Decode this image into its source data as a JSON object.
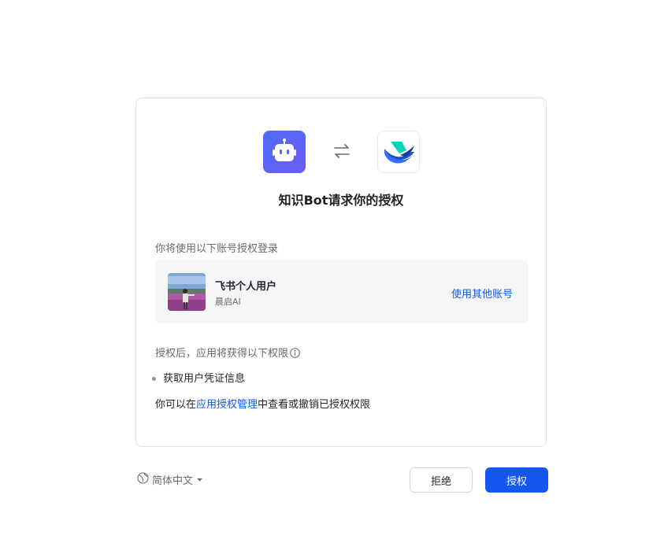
{
  "header": {
    "app_icon": "robot-icon",
    "swap_icon": "swap-arrows-icon",
    "target_icon": "feishu-logo-icon",
    "title": "知识Bot请求你的授权"
  },
  "account": {
    "section_label": "你将使用以下账号授权登录",
    "name": "飞书个人用户",
    "org": "晨启AI",
    "switch_label": "使用其他账号"
  },
  "permissions": {
    "label": "授权后，应用将获得以下权限",
    "items": [
      "获取用户凭证信息"
    ],
    "manage_prefix": "你可以在",
    "manage_link": "应用授权管理",
    "manage_suffix": "中查看或撤销已授权权限"
  },
  "footer": {
    "language": "简体中文",
    "reject_label": "拒绝",
    "authorize_label": "授权"
  },
  "colors": {
    "accent": "#1456f0",
    "app_icon_bg": "#5b63f5"
  }
}
